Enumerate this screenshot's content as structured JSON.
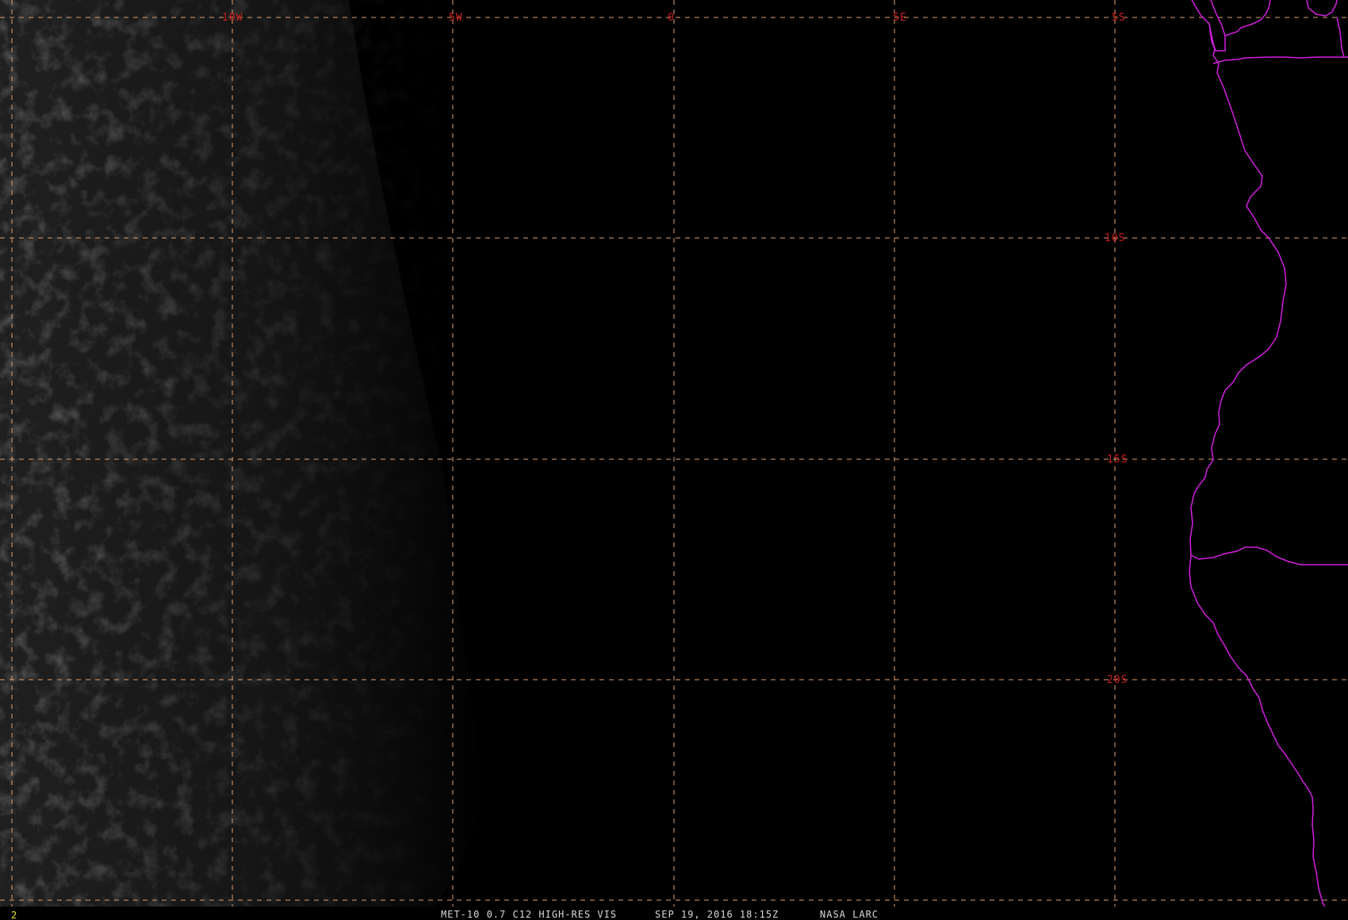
{
  "map": {
    "longitude_labels": [
      "10W",
      "5W",
      "0",
      "5E"
    ],
    "latitude_labels": [
      "5S",
      "10S",
      "15S",
      "20S"
    ],
    "colors": {
      "background": "#000000",
      "grid_lines": "#e0a070",
      "grid_labels": "#c81e1e",
      "coastline": "#d21ee0",
      "caption": "#d8d8d8",
      "frame_number": "#e6e61e"
    }
  },
  "caption": {
    "product": "MET-10 0.7 C12 HIGH-RES VIS",
    "datetime": "SEP 19, 2016 18:15Z",
    "source": "NASA LARC"
  },
  "frame_number": "2"
}
